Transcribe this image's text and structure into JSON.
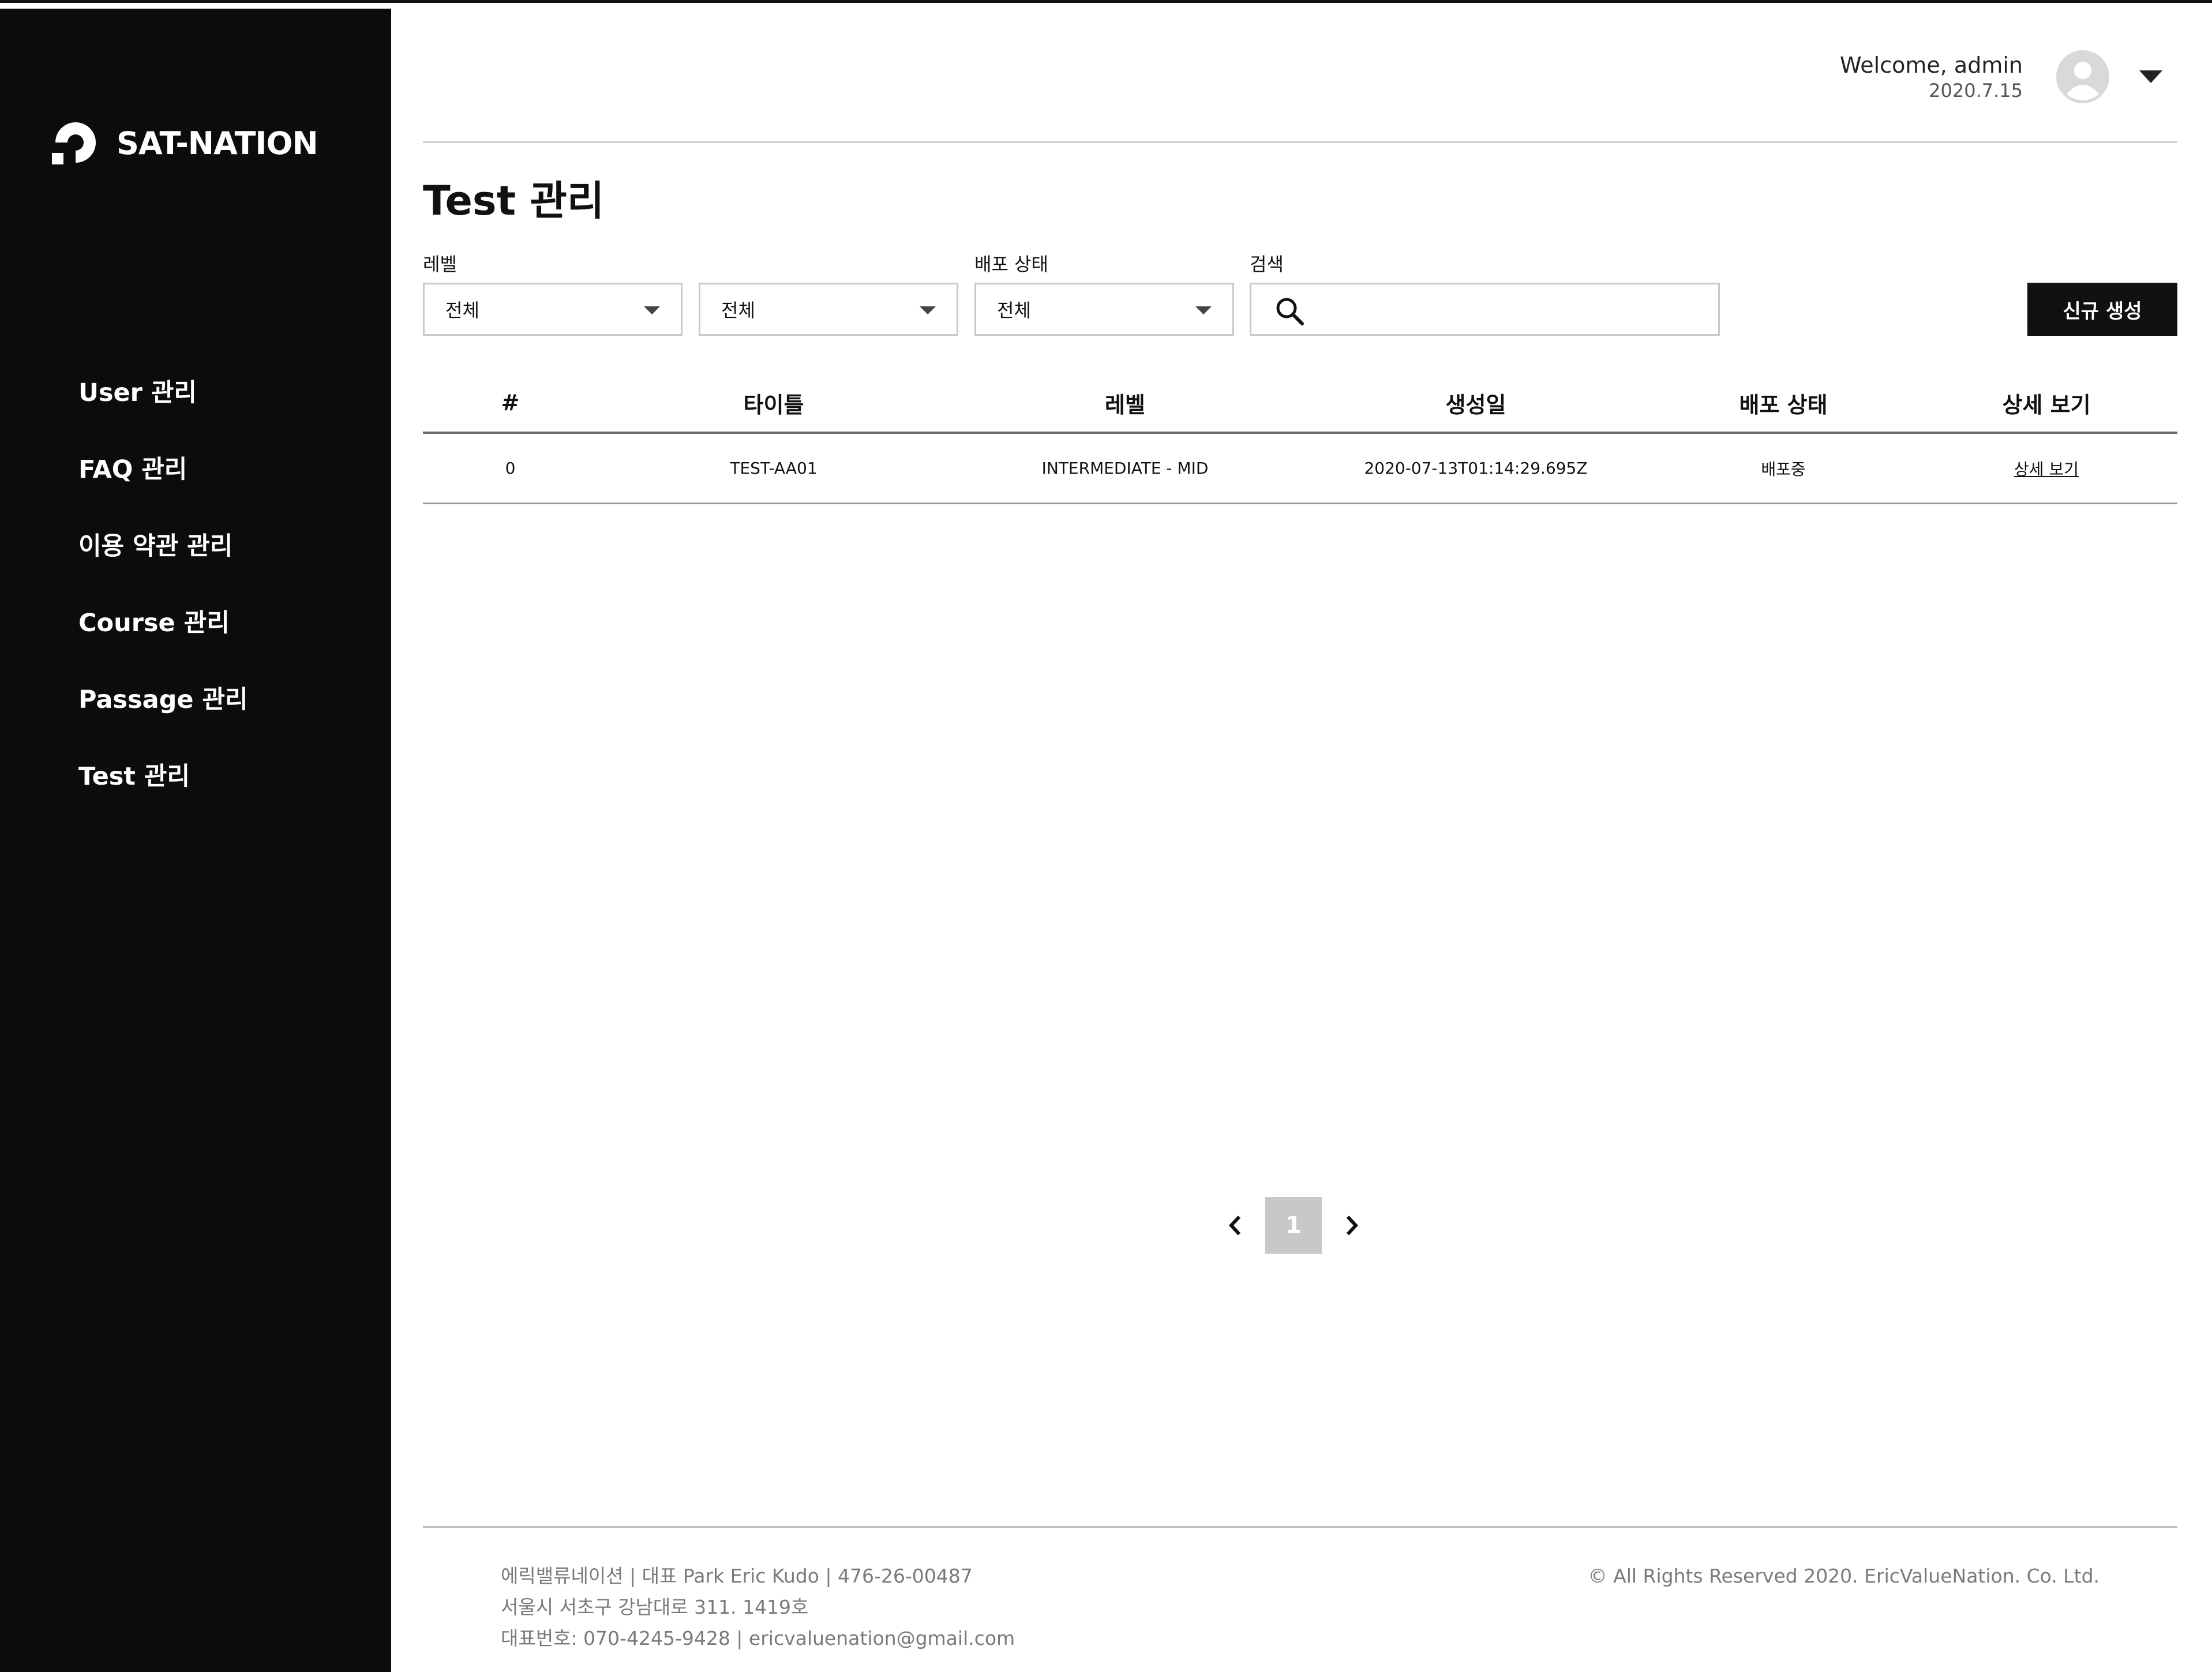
{
  "brand": {
    "name": "SAT-NATION"
  },
  "sidebar": {
    "items": [
      {
        "label": "User 관리"
      },
      {
        "label": "FAQ 관리"
      },
      {
        "label": "이용 약관 관리"
      },
      {
        "label": "Course 관리"
      },
      {
        "label": "Passage 관리"
      },
      {
        "label": "Test 관리"
      }
    ]
  },
  "header": {
    "welcome": "Welcome, admin",
    "date": "2020.7.15"
  },
  "page": {
    "title": "Test 관리"
  },
  "filters": {
    "level_label": "레벨",
    "level_value": "전체",
    "level2_value": "전체",
    "deploy_label": "배포 상태",
    "deploy_value": "전체",
    "search_label": "검색",
    "search_value": ""
  },
  "actions": {
    "new_label": "신규 생성"
  },
  "table": {
    "headers": [
      "#",
      "타이틀",
      "레벨",
      "생성일",
      "배포 상태",
      "상세 보기"
    ],
    "rows": [
      {
        "num": "0",
        "title": "TEST-AA01",
        "level": "INTERMEDIATE - MID",
        "created": "2020-07-13T01:14:29.695Z",
        "status": "배포중",
        "detail": "상세 보기"
      }
    ]
  },
  "pagination": {
    "current": "1"
  },
  "footer": {
    "line1": "에릭밸류네이션 | 대표 Park Eric Kudo | 476-26-00487",
    "line2": "서울시 서초구 강남대로 311. 1419호",
    "line3": "대표번호: 070-4245-9428 | ericvaluenation@gmail.com",
    "copyright": "© All Rights Reserved 2020. EricValueNation. Co. Ltd."
  }
}
